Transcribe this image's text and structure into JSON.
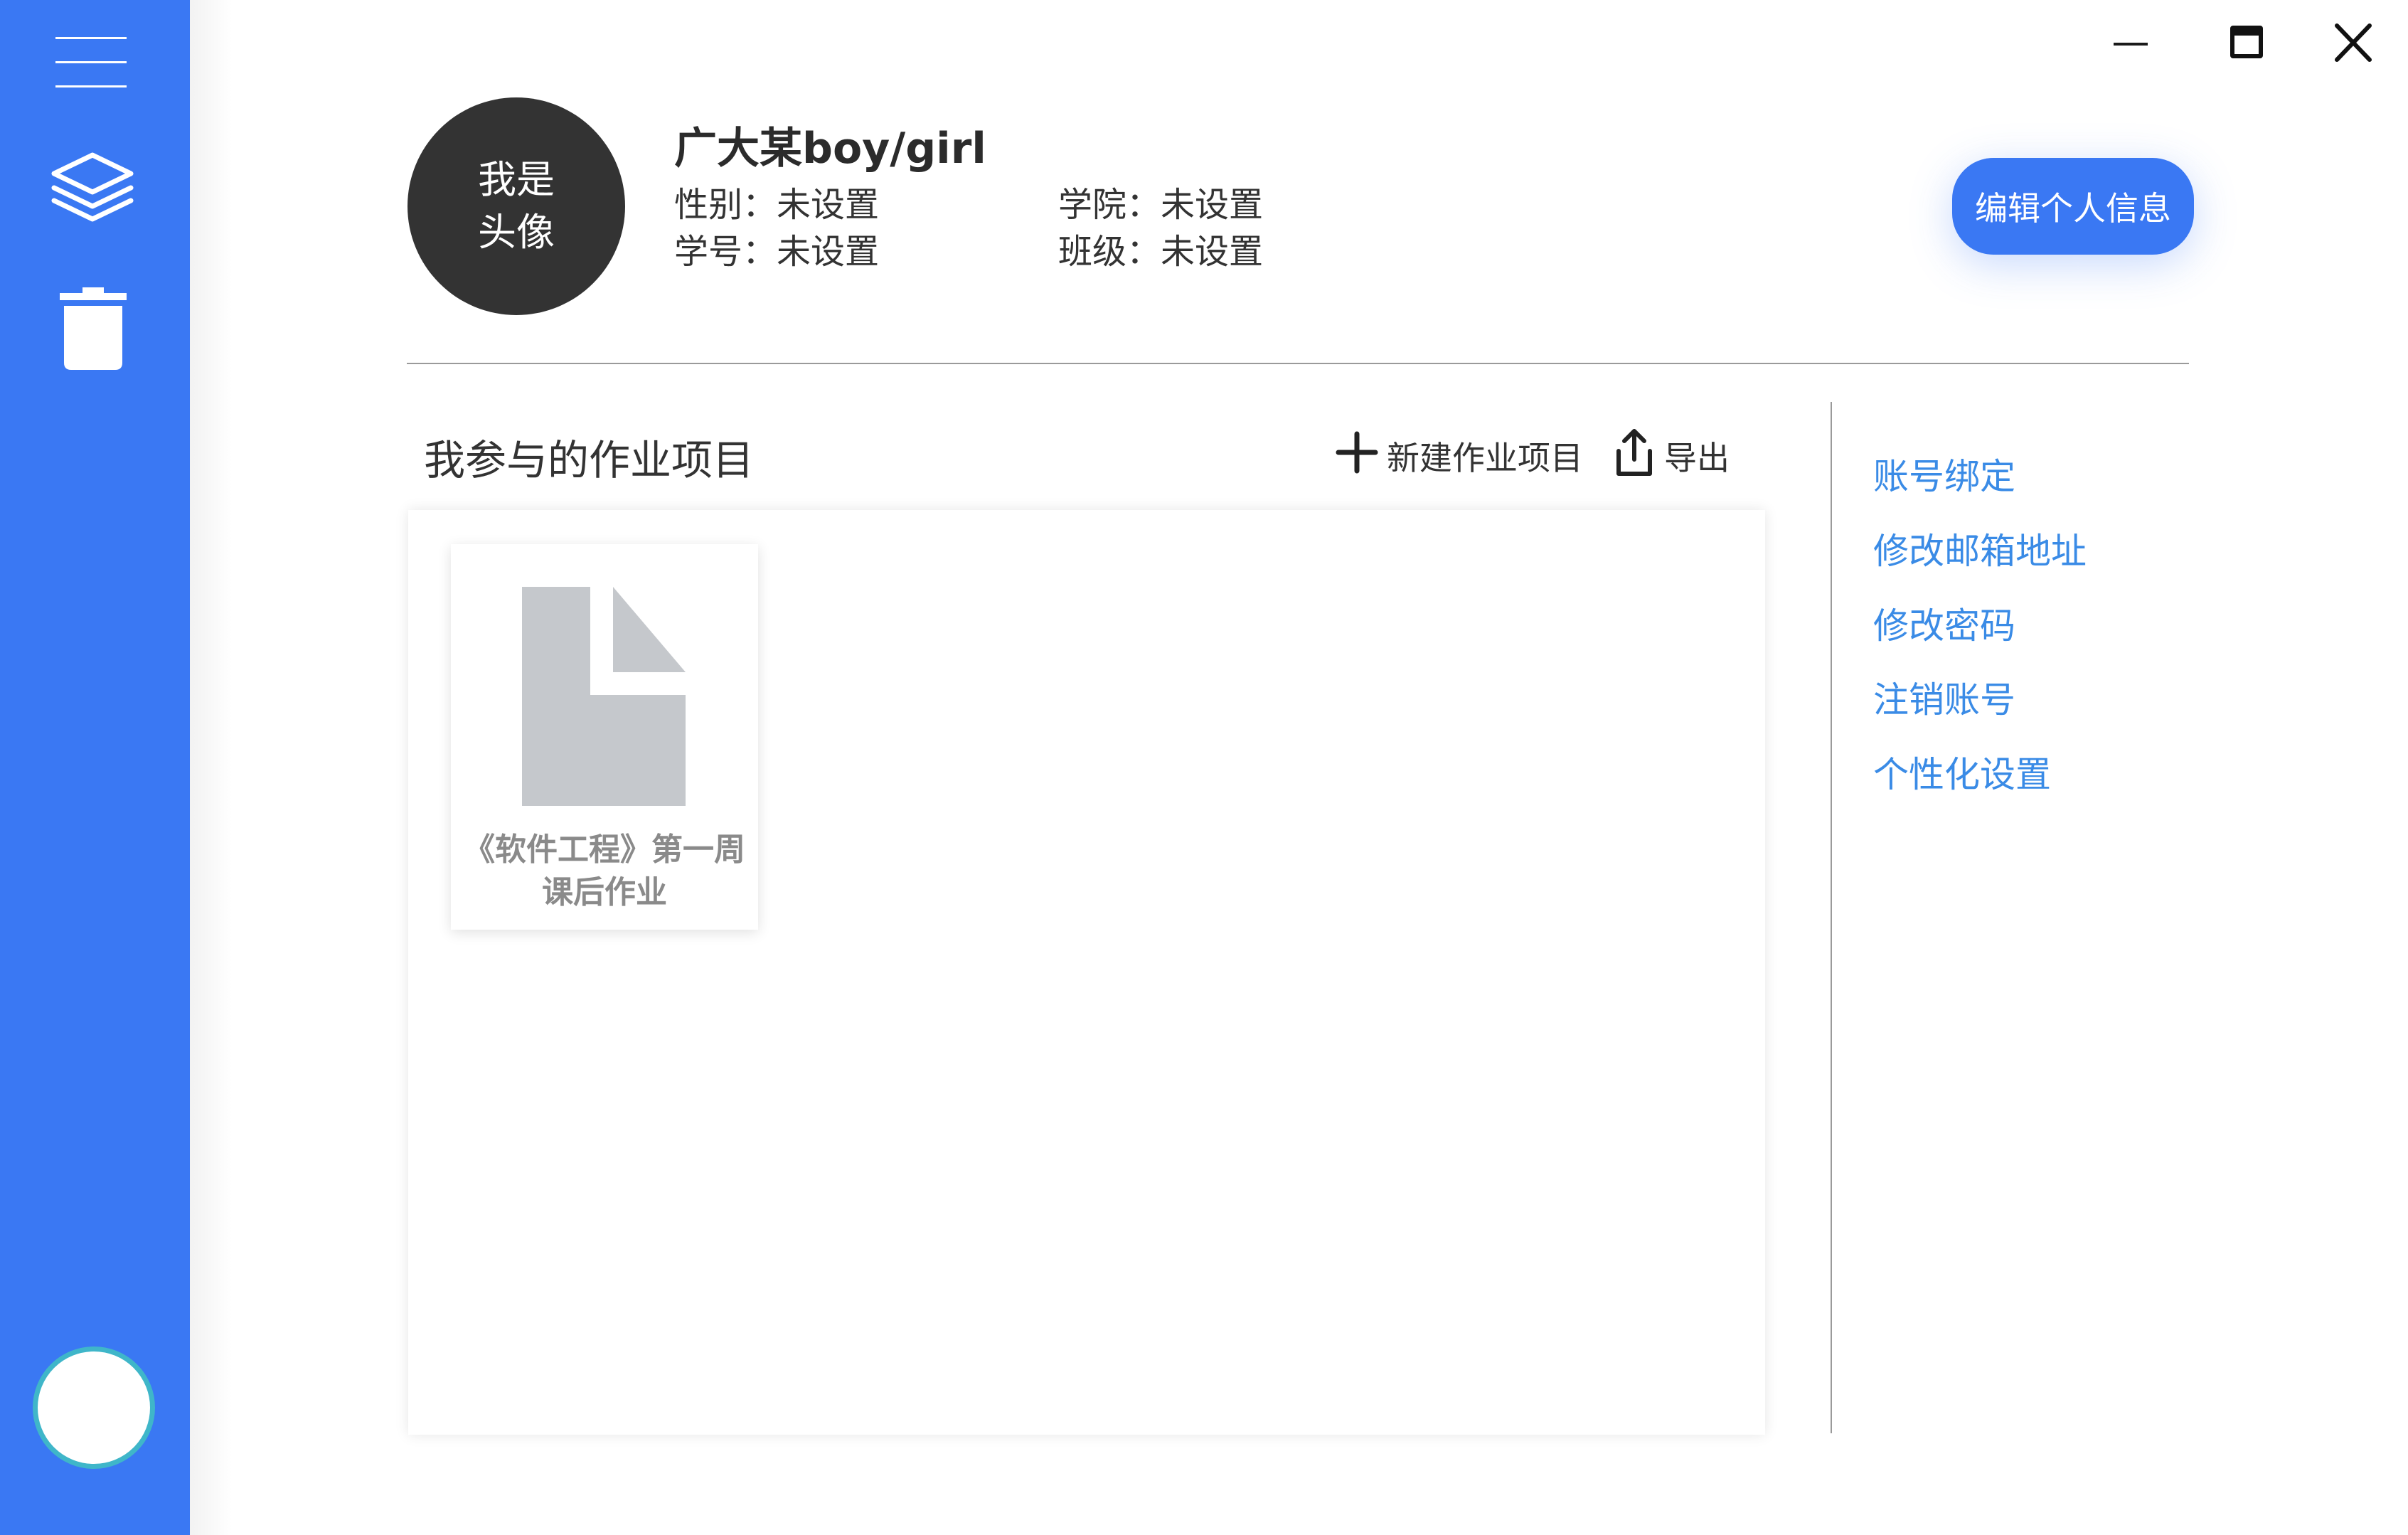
{
  "sidebar": {
    "menu_icon": "hamburger-menu-icon",
    "layers_icon": "layers-icon",
    "trash_icon": "trash-icon",
    "user_icon": "user-circle-icon",
    "accent_color": "#3a78f3"
  },
  "window": {
    "minimize_icon": "minimize-icon",
    "maximize_icon": "maximize-icon",
    "close_icon": "close-icon"
  },
  "profile": {
    "avatar_text": "我是\n头像",
    "name": "广大某boy/girl",
    "gender": "性别：未设置",
    "student_id": "学号：未设置",
    "college": "学院：未设置",
    "class": "班级：未设置",
    "edit_button": "编辑个人信息"
  },
  "projects": {
    "section_title": "我参与的作业项目",
    "new_button": "新建作业项目",
    "export_button": "导出",
    "items": [
      {
        "title": "《软件工程》第一周\n课后作业",
        "icon": "document-icon"
      }
    ]
  },
  "settings": {
    "links": [
      "账号绑定",
      "修改邮箱地址",
      "修改密码",
      "注销账号",
      "个性化设置"
    ],
    "link_color": "#3a8be6"
  }
}
